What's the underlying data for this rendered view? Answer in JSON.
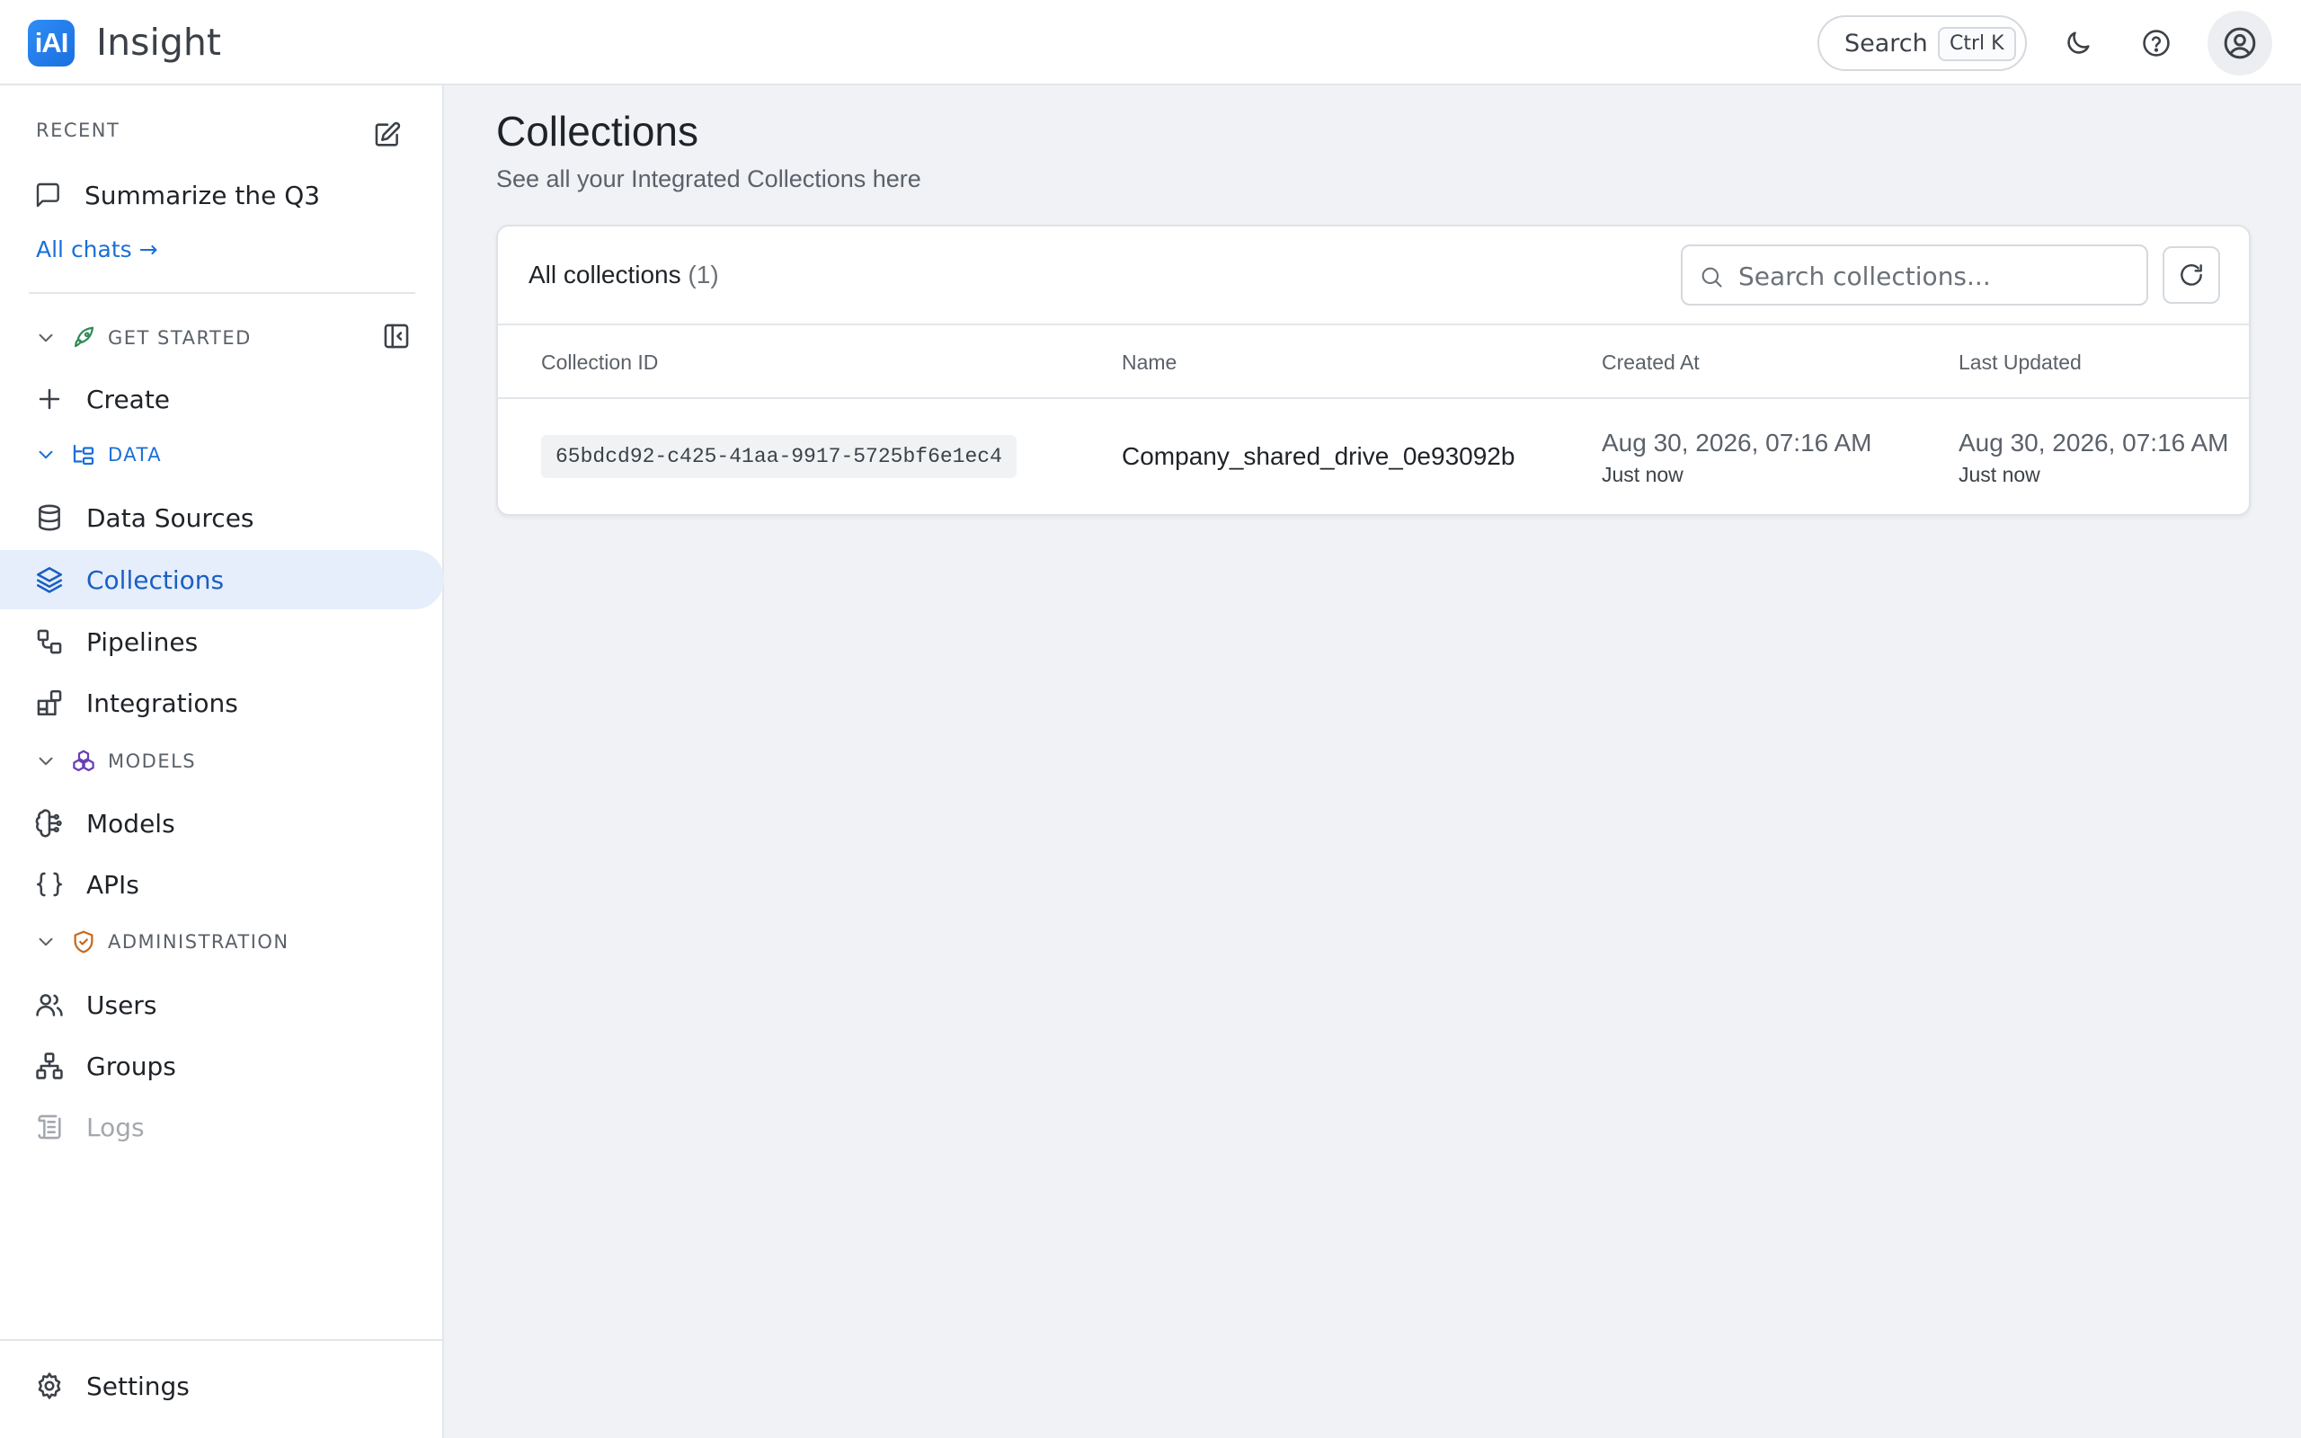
{
  "app": {
    "logo_text": "iAI",
    "title": "Insight"
  },
  "header": {
    "search_label": "Search",
    "search_shortcut": "Ctrl K"
  },
  "sidebar": {
    "recent_header": "RECENT",
    "recent_items": [
      "Summarize the Q3"
    ],
    "all_chats": "All chats →",
    "sections": {
      "get_started": "GET STARTED",
      "data": "DATA",
      "models": "MODELS",
      "administration": "ADMINISTRATION"
    },
    "items": {
      "create": "Create",
      "data_sources": "Data Sources",
      "collections": "Collections",
      "pipelines": "Pipelines",
      "integrations": "Integrations",
      "models": "Models",
      "apis": "APIs",
      "users": "Users",
      "groups": "Groups",
      "logs": "Logs",
      "settings": "Settings"
    },
    "active_item": "collections"
  },
  "main": {
    "title": "Collections",
    "subtitle": "See all your Integrated Collections here",
    "card": {
      "title": "All collections",
      "count": "(1)",
      "search_placeholder": "Search collections..."
    },
    "table": {
      "columns": [
        "Collection ID",
        "Name",
        "Created At",
        "Last Updated"
      ],
      "rows": [
        {
          "id": "65bdcd92-c425-41aa-9917-5725bf6e1ec4",
          "name": "Company_shared_drive_0e93092b",
          "created_at": "Aug 30, 2026, 07:16 AM",
          "created_rel": "Just now",
          "updated_at": "Aug 30, 2026, 07:16 AM",
          "updated_rel": "Just now"
        }
      ]
    }
  },
  "colors": {
    "accent": "#1a6fd8",
    "active_bg": "#e6eefb",
    "get_started_icon": "#2e8b57",
    "data_icon": "#1a6fd8",
    "models_icon": "#6a3fb5",
    "administration_icon": "#c8681a"
  }
}
